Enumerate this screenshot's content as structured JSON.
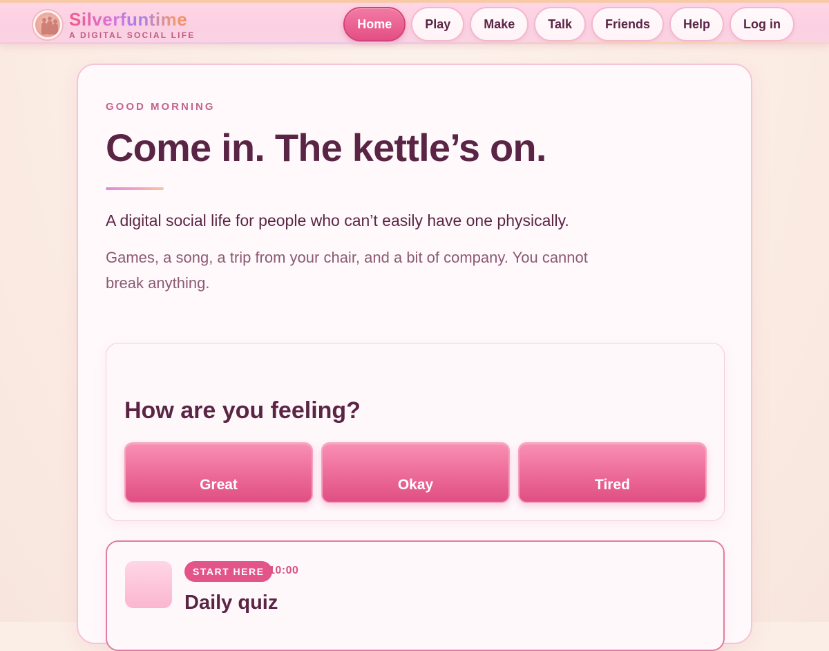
{
  "brand": {
    "name": "Silverfuntime",
    "tagline": "A DIGITAL SOCIAL LIFE",
    "logo_icon": "people-logo-icon"
  },
  "nav": {
    "items": [
      {
        "label": "Home",
        "active": true
      },
      {
        "label": "Play",
        "active": false
      },
      {
        "label": "Make",
        "active": false
      },
      {
        "label": "Talk",
        "active": false
      },
      {
        "label": "Friends",
        "active": false
      },
      {
        "label": "Help",
        "active": false
      },
      {
        "label": "Log in",
        "active": false
      }
    ]
  },
  "hero": {
    "eyebrow": "GOOD MORNING",
    "title": "Come in. The kettle’s on.",
    "lead": "A digital social life for people who can’t easily have one physically.",
    "sub": "Games, a song, a trip from your chair, and a bit of company. You cannot break anything."
  },
  "feeling": {
    "question": "How are you feeling?",
    "options": [
      "Great",
      "Okay",
      "Tired"
    ]
  },
  "activity": {
    "badge": "START HERE",
    "time": "10:00",
    "title": "Daily quiz"
  },
  "colors": {
    "accent": "#e44f83",
    "text": "#5a2545",
    "muted": "#8a5a72",
    "eyebrow": "#c4638c"
  }
}
